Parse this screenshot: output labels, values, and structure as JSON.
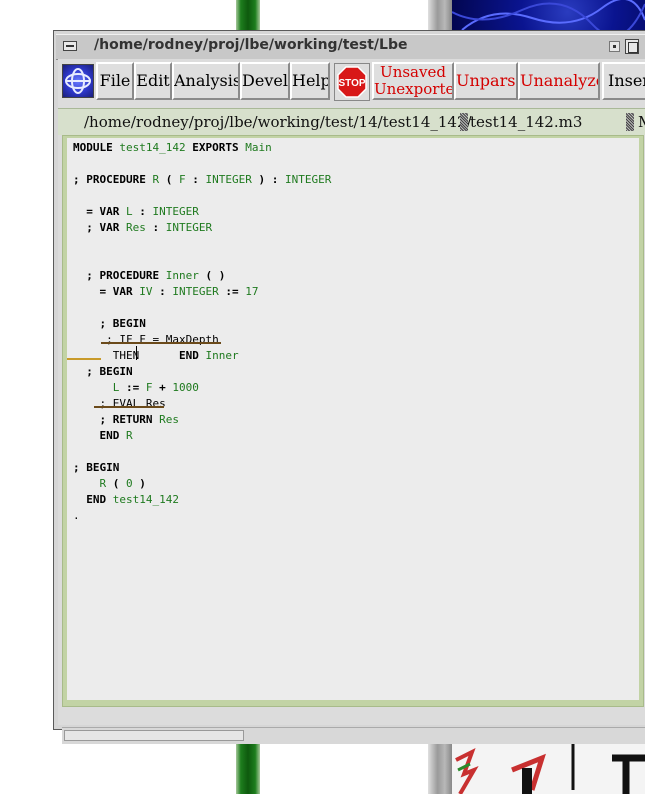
{
  "window": {
    "title": "/home/rodney/proj/lbe/working/test/Lbe"
  },
  "toolbar": {
    "menus": [
      "File",
      "Edit",
      "Analysis",
      "Devel",
      "Help"
    ],
    "stop_label": "STOP",
    "status": {
      "unsaved": "Unsaved",
      "unexported": "Unexported",
      "unparsed": "Unparsed",
      "unanalyzed": "Unanalyzed",
      "insert": "Insert"
    }
  },
  "pathbar": {
    "directory": "/home/rodney/proj/lbe/working/test/14/test14_142/",
    "file": "test14_142.m3",
    "trailing": "M"
  },
  "editor": {
    "lines": [
      [
        {
          "k": "MODULE"
        },
        {
          "t": " "
        },
        {
          "i": "test14_142"
        },
        {
          "t": " "
        },
        {
          "k": "EXPORTS"
        },
        {
          "t": " "
        },
        {
          "i": "Main"
        }
      ],
      [],
      [
        {
          "k": ";"
        },
        {
          "t": " "
        },
        {
          "k": "PROCEDURE"
        },
        {
          "t": " "
        },
        {
          "i": "R"
        },
        {
          "t": " "
        },
        {
          "k": "("
        },
        {
          "t": " "
        },
        {
          "i": "F"
        },
        {
          "t": " "
        },
        {
          "k": ":"
        },
        {
          "t": " "
        },
        {
          "i": "INTEGER"
        },
        {
          "t": " "
        },
        {
          "k": ")"
        },
        {
          "t": " "
        },
        {
          "k": ":"
        },
        {
          "t": " "
        },
        {
          "i": "INTEGER"
        }
      ],
      [],
      [
        {
          "t": "  "
        },
        {
          "k": "="
        },
        {
          "t": " "
        },
        {
          "k": "VAR"
        },
        {
          "t": " "
        },
        {
          "i": "L"
        },
        {
          "t": " "
        },
        {
          "k": ":"
        },
        {
          "t": " "
        },
        {
          "i": "INTEGER"
        }
      ],
      [
        {
          "t": "  "
        },
        {
          "k": ";"
        },
        {
          "t": " "
        },
        {
          "k": "VAR"
        },
        {
          "t": " "
        },
        {
          "i": "Res"
        },
        {
          "t": " "
        },
        {
          "k": ":"
        },
        {
          "t": " "
        },
        {
          "i": "INTEGER"
        }
      ],
      [],
      [],
      [
        {
          "t": "  "
        },
        {
          "k": ";"
        },
        {
          "t": " "
        },
        {
          "k": "PROCEDURE"
        },
        {
          "t": " "
        },
        {
          "i": "Inner"
        },
        {
          "t": " "
        },
        {
          "k": "("
        },
        {
          "t": " "
        },
        {
          "k": ")"
        }
      ],
      [
        {
          "t": "    "
        },
        {
          "k": "="
        },
        {
          "t": " "
        },
        {
          "k": "VAR"
        },
        {
          "t": " "
        },
        {
          "i": "IV"
        },
        {
          "t": " "
        },
        {
          "k": ":"
        },
        {
          "t": " "
        },
        {
          "i": "INTEGER"
        },
        {
          "t": " "
        },
        {
          "k": ":="
        },
        {
          "t": " "
        },
        {
          "i": "17"
        }
      ],
      [],
      [
        {
          "t": "    "
        },
        {
          "k": ";"
        },
        {
          "t": " "
        },
        {
          "k": "BEGIN"
        }
      ],
      [
        {
          "t": "     "
        },
        {
          "t": "; IF F = MaxDepth"
        }
      ],
      [
        {
          "t": "      "
        },
        {
          "t": "THEN"
        },
        {
          "t": "      "
        },
        {
          "k": "END"
        },
        {
          "t": " "
        },
        {
          "i": "Inner"
        }
      ],
      [
        {
          "t": "  "
        },
        {
          "k": ";"
        },
        {
          "t": " "
        },
        {
          "k": "BEGIN"
        }
      ],
      [
        {
          "t": "      "
        },
        {
          "i": "L"
        },
        {
          "t": " "
        },
        {
          "k": ":="
        },
        {
          "t": " "
        },
        {
          "i": "F"
        },
        {
          "t": " "
        },
        {
          "k": "+"
        },
        {
          "t": " "
        },
        {
          "i": "1000"
        }
      ],
      [
        {
          "t": "    "
        },
        {
          "t": "; EVAL Res"
        }
      ],
      [
        {
          "t": "    "
        },
        {
          "k": ";"
        },
        {
          "t": " "
        },
        {
          "k": "RETURN"
        },
        {
          "t": " "
        },
        {
          "i": "Res"
        }
      ],
      [
        {
          "t": "    "
        },
        {
          "k": "END"
        },
        {
          "t": " "
        },
        {
          "i": "R"
        }
      ],
      [],
      [
        {
          "k": ";"
        },
        {
          "t": " "
        },
        {
          "k": "BEGIN"
        }
      ],
      [
        {
          "t": "    "
        },
        {
          "i": "R"
        },
        {
          "t": " "
        },
        {
          "k": "("
        },
        {
          "t": " "
        },
        {
          "i": "0"
        },
        {
          "t": " "
        },
        {
          "k": ")"
        }
      ],
      [
        {
          "t": "  "
        },
        {
          "k": "END"
        },
        {
          "t": " "
        },
        {
          "i": "test14_142"
        }
      ],
      [
        {
          "t": "."
        }
      ]
    ]
  },
  "colors": {
    "identifier": "#1f7a1f",
    "status_text": "#d40000",
    "error_underline": "#6b4a1a",
    "error_underline_alt": "#c89a2a",
    "editor_frame": "#c2d3a5"
  },
  "icons": {
    "window_menu": "window-menu-icon",
    "iconify": "iconify-icon",
    "maximize": "maximize-icon",
    "logo": "lbe-logo-icon",
    "stop": "stop-sign-icon"
  }
}
